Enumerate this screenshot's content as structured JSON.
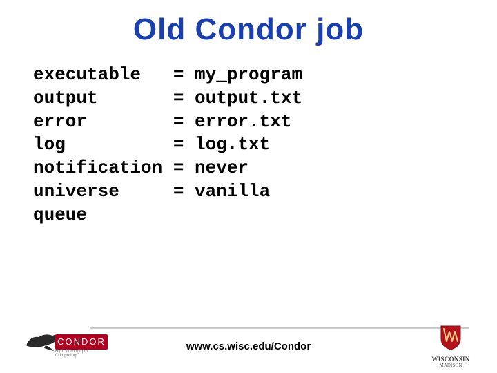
{
  "title": "Old Condor job",
  "code": {
    "lines": [
      {
        "key": "executable",
        "value": "my_program"
      },
      {
        "key": "output",
        "value": "output.txt"
      },
      {
        "key": "error",
        "value": "error.txt"
      },
      {
        "key": "log",
        "value": "log.txt"
      },
      {
        "key": "notification",
        "value": "never"
      },
      {
        "key": "universe",
        "value": "vanilla"
      }
    ],
    "trailing": "queue"
  },
  "footer": {
    "url": "www.cs.wisc.edu/Condor",
    "condor_label": "CONDOR",
    "condor_sub": "High Throughput Computing",
    "wisc_name": "WISCONSIN",
    "wisc_sub": "MADISON"
  }
}
